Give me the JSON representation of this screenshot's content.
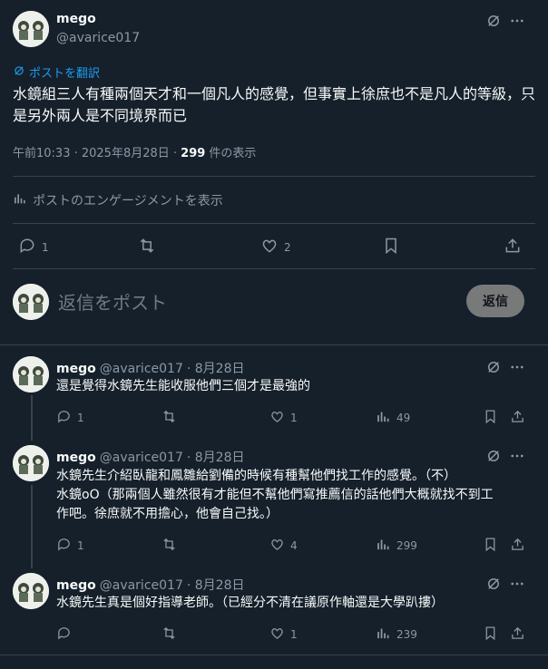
{
  "main_tweet": {
    "name": "mego",
    "handle": "@avarice017",
    "translate_label": "ポストを翻訳",
    "text": "水鏡組三人有種兩個天才和一個凡人的感覺，但事實上徐庶也不是凡人的等級，只是另外兩人是不同境界而已",
    "meta_time": "午前10:33 · 2025年8月28日 · ",
    "meta_views": "299",
    "meta_views_suffix": " 件の表示",
    "engagement_label": "ポストのエンゲージメントを表示",
    "replies": "1",
    "likes": "2"
  },
  "reply_box": {
    "placeholder": "返信をポスト",
    "button_label": "返信"
  },
  "replies": [
    {
      "name": "mego",
      "handle": "@avarice017",
      "date": "· 8月28日",
      "text": "還是覺得水鏡先生能收服他們三個才是最強的",
      "replies": "1",
      "likes": "1",
      "views": "49"
    },
    {
      "name": "mego",
      "handle": "@avarice017",
      "date": "· 8月28日",
      "text_line1": "水鏡先生介紹臥龍和鳳雛給劉備的時候有種幫他們找工作的感覺。（不）",
      "text_line2": "水鏡oO（那兩個人雖然很有才能但不幫他們寫推薦信的話他們大概就找不到工",
      "text_line3": "作吧。徐庶就不用擔心，他會自己找。）",
      "replies": "1",
      "likes": "4",
      "views": "299"
    },
    {
      "name": "mego",
      "handle": "@avarice017",
      "date": "· 8月28日",
      "text": "水鏡先生真是個好指導老師。（已經分不清在議原作軸還是大學趴摟）",
      "replies": "",
      "likes": "1",
      "views": "239"
    }
  ],
  "icons": [
    "avatar",
    "grok-icon",
    "more-icon",
    "translate-icon",
    "analytics-icon",
    "reply-icon",
    "retweet-icon",
    "like-icon",
    "bookmark-icon",
    "share-icon"
  ],
  "colors": {
    "background": "#15202b",
    "accent": "#1d9bf0",
    "muted": "#8b98a5",
    "divider": "#38444d"
  }
}
